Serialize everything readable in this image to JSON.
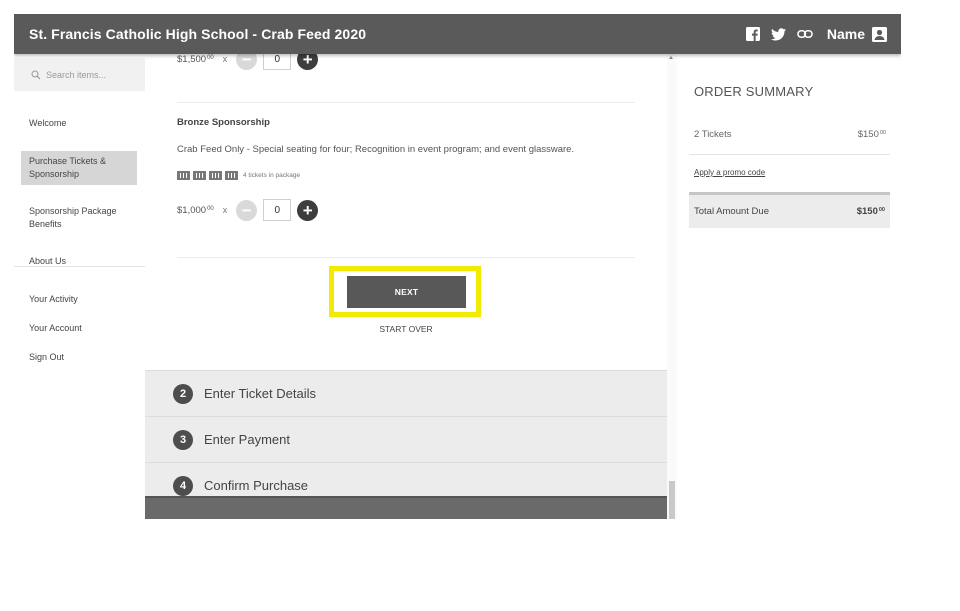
{
  "header": {
    "title": "St. Francis Catholic High School - Crab Feed 2020",
    "user_name": "Name",
    "icons": [
      "facebook-icon",
      "twitter-icon",
      "link-icon",
      "user-icon"
    ]
  },
  "sidebar": {
    "search_placeholder": "Search items...",
    "items": [
      {
        "label": "Welcome"
      },
      {
        "label": "Purchase Tickets & Sponsorship",
        "active": true
      },
      {
        "label": "Sponsorship Package Benefits"
      },
      {
        "label": "About Us"
      },
      {
        "label": "Your Activity"
      },
      {
        "label": "Your Account"
      },
      {
        "label": "Sign Out"
      }
    ]
  },
  "main": {
    "cut_price": "$1,500",
    "cut_price_cents": "00",
    "cut_qty": "0",
    "package": {
      "name": "Bronze Sponsorship",
      "description": "Crab Feed Only - Special seating for four; Recognition in event program; and event glassware.",
      "tickets_note": "4 tickets in package",
      "price": "$1,000",
      "price_cents": "00",
      "times": "x",
      "quantity": "0"
    },
    "next_label": "NEXT",
    "start_over_label": "START OVER",
    "steps": [
      {
        "number": "2",
        "label": "Enter Ticket Details"
      },
      {
        "number": "3",
        "label": "Enter Payment"
      },
      {
        "number": "4",
        "label": "Confirm Purchase"
      }
    ]
  },
  "summary": {
    "heading": "ORDER SUMMARY",
    "tickets_label": "2 Tickets",
    "tickets_amount": "$150",
    "tickets_cents": "00",
    "promo_label": "Apply a promo code",
    "total_label": "Total Amount Due",
    "total_amount": "$150",
    "total_cents": "00"
  },
  "colors": {
    "header_bg": "#5a5a5a",
    "highlight": "#f2ea00",
    "button_bg": "#585858"
  }
}
